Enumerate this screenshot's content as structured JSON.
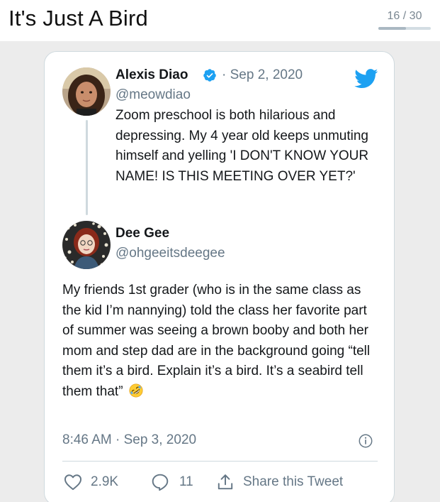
{
  "header": {
    "title": "It's Just A Bird",
    "page_counter": "16 / 30",
    "progress_fraction": 0.533
  },
  "quoted_tweet": {
    "author_name": "Alexis Diao",
    "verified": true,
    "date": "· Sep 2, 2020",
    "handle": "@meowdiao",
    "text": "Zoom preschool is both hilarious and depressing. My 4 year old keeps unmuting himself and yelling 'I DON'T KNOW YOUR NAME! IS THIS MEETING OVER YET?'"
  },
  "reply_tweet": {
    "author_name": "Dee Gee",
    "handle": "@ohgeeitsdeegee",
    "text": "My friends 1st grader (who is in the same class as the kid I’m nannying) told the class her favorite part of summer was seeing a brown booby and both her mom and step dad are in the background going “tell them it’s a bird. Explain it’s a bird. It’s a seabird tell them that”",
    "emoji": "rolling-on-floor-laughing",
    "timestamp": "8:46 AM · Sep 3, 2020"
  },
  "actions": {
    "like_count": "2.9K",
    "reply_count": "11",
    "share_label": "Share this Tweet"
  },
  "icons": {
    "verified": "verified-badge-icon",
    "brand": "twitter-bird-icon",
    "info": "info-icon",
    "like": "heart-icon",
    "reply": "speech-bubble-icon",
    "share": "share-upload-icon"
  },
  "colors": {
    "twitter_blue": "#1da1f2",
    "secondary_text": "#657786",
    "border": "#cfd9de",
    "background": "#ececec"
  }
}
